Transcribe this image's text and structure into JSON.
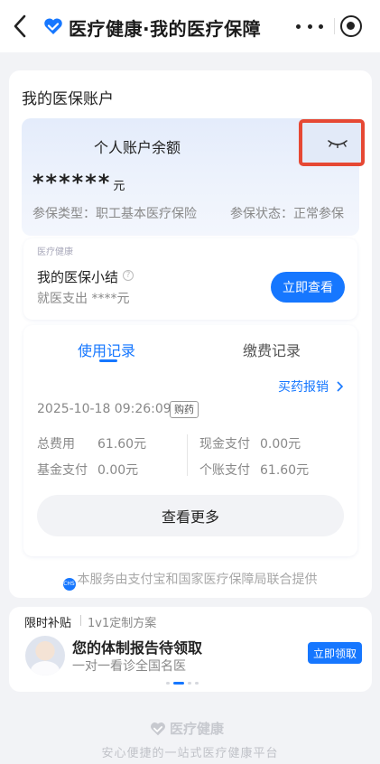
{
  "header": {
    "title": "医疗健康·我的医疗保障",
    "back_icon": "back-arrow-icon",
    "more_icon": "more-dots-icon",
    "record_icon": "record-circle-icon"
  },
  "account": {
    "section_title": "我的医保账户",
    "balance_label": "个人账户余额",
    "balance_masked": "******",
    "balance_unit": "元",
    "insurance_type": "参保类型：职工基本医疗保险",
    "insurance_status": "参保状态：正常参保",
    "eye_icon": "eye-closed-icon",
    "highlight_color": "#e64834"
  },
  "summary": {
    "source": "医疗健康",
    "title": "我的医保小结",
    "info_icon": "info-icon",
    "subtitle": "就医支出 ****元",
    "button": "立即查看"
  },
  "records": {
    "tabs": [
      {
        "label": "使用记录",
        "active": true
      },
      {
        "label": "缴费记录",
        "active": false
      }
    ],
    "buy_link": "买药报销",
    "time": "2025-10-18 09:26:09",
    "tag": "购药",
    "fields": {
      "total_label": "总费用",
      "total_value": "61.60元",
      "cash_label": "现金支付",
      "cash_value": "0.00元",
      "fund_label": "基金支付",
      "fund_value": "0.00元",
      "personal_label": "个账支付",
      "personal_value": "61.60元"
    },
    "more_button": "查看更多"
  },
  "provider_note": "本服务由支付宝和国家医疗保障局联合提供",
  "promo": {
    "tag": "限时补贴",
    "tag_sub": "1v1定制方案",
    "title": "您的体制报告待领取",
    "desc": "一对一看诊全国名医",
    "button": "立即领取"
  },
  "footer": {
    "brand": "医疗健康",
    "slogan": "安心便捷的一站式医疗健康平台"
  },
  "colors": {
    "accent": "#1677ff",
    "background": "#f2f3f6"
  }
}
